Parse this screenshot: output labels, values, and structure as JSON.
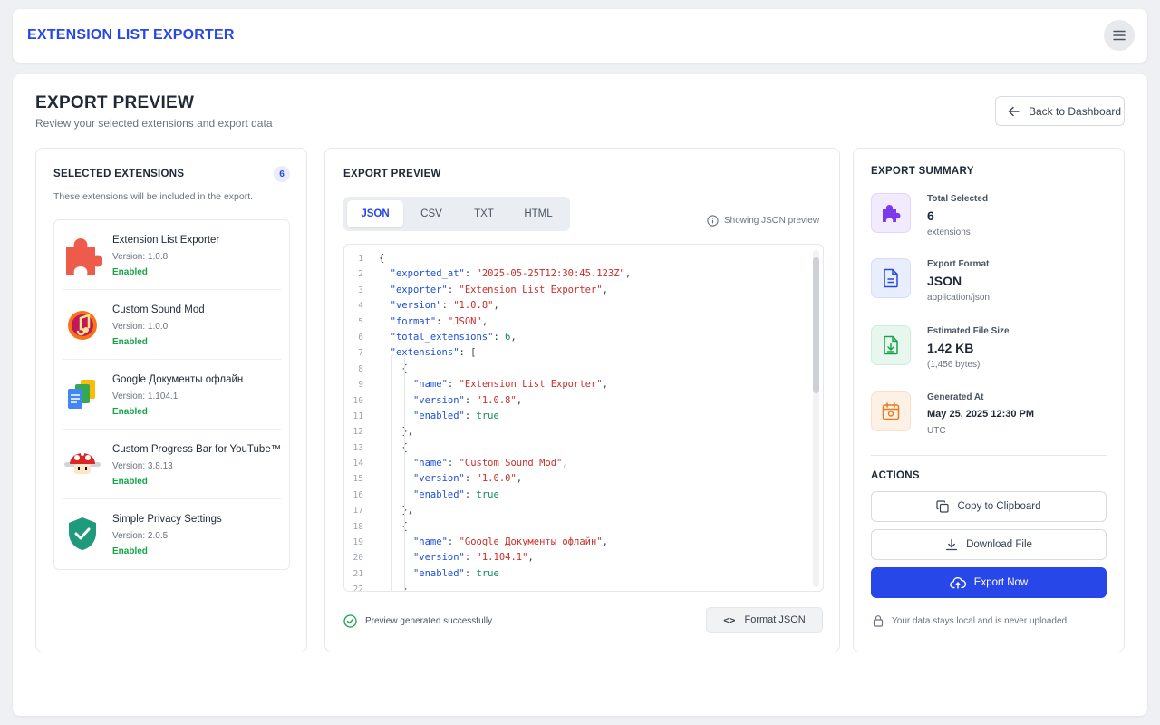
{
  "app": {
    "title": "EXTENSION LIST EXPORTER"
  },
  "header": {
    "title": "EXPORT PREVIEW",
    "subtitle": "Review your selected extensions and export data",
    "back_label": "Back to Dashboard"
  },
  "selected": {
    "title": "SELECTED EXTENSIONS",
    "count": "6",
    "description": "These extensions will be included in the export.",
    "items": [
      {
        "name": "Extension List Exporter",
        "version": "Version: 1.0.8",
        "status": "Enabled",
        "icon": "puzzle-icon"
      },
      {
        "name": "Custom Sound Mod",
        "version": "Version: 1.0.0",
        "status": "Enabled",
        "icon": "music-note-icon"
      },
      {
        "name": "Google Документы офлайн",
        "version": "Version: 1.104.1",
        "status": "Enabled",
        "icon": "google-docs-icon"
      },
      {
        "name": "Custom Progress Bar for YouTube™",
        "version": "Version: 3.8.13",
        "status": "Enabled",
        "icon": "mushroom-icon"
      },
      {
        "name": "Simple Privacy Settings",
        "version": "Version: 2.0.5",
        "status": "Enabled",
        "icon": "shield-check-icon"
      }
    ]
  },
  "preview": {
    "title": "EXPORT PREVIEW",
    "tabs": [
      "JSON",
      "CSV",
      "TXT",
      "HTML"
    ],
    "active_tab": "JSON",
    "showing": "Showing JSON preview",
    "status": "Preview generated successfully",
    "format_button": "Format JSON",
    "code_lines": [
      "{",
      "  \"exported_at\": \"2025-05-25T12:30:45.123Z\",",
      "  \"exporter\": \"Extension List Exporter\",",
      "  \"version\": \"1.0.8\",",
      "  \"format\": \"JSON\",",
      "  \"total_extensions\": 6,",
      "  \"extensions\": [",
      "    {",
      "      \"name\": \"Extension List Exporter\",",
      "      \"version\": \"1.0.8\",",
      "      \"enabled\": true",
      "    },",
      "    {",
      "      \"name\": \"Custom Sound Mod\",",
      "      \"version\": \"1.0.0\",",
      "      \"enabled\": true",
      "    },",
      "    {",
      "      \"name\": \"Google Документы офлайн\",",
      "      \"version\": \"1.104.1\",",
      "      \"enabled\": true",
      "    }"
    ]
  },
  "summary": {
    "title": "EXPORT SUMMARY",
    "items": [
      {
        "label": "Total Selected",
        "value": "6",
        "sub": "extensions",
        "icon": "puzzle-icon",
        "color": "#7c3aed",
        "bg": "#f1ebfd"
      },
      {
        "label": "Export Format",
        "value": "JSON",
        "sub": "application/json",
        "icon": "document-icon",
        "color": "#2747e8",
        "bg": "#e9eefc"
      },
      {
        "label": "Estimated File Size",
        "value": "1.42 KB",
        "sub": "(1,456 bytes)",
        "icon": "file-download-icon",
        "color": "#16a34a",
        "bg": "#e8f7ee"
      },
      {
        "label": "Generated At",
        "value": "May 25, 2025 12:30 PM",
        "sub": "UTC",
        "icon": "calendar-icon",
        "color": "#ea7a1a",
        "bg": "#fdf1e6"
      }
    ],
    "actions_title": "ACTIONS",
    "copy_label": "Copy to Clipboard",
    "download_label": "Download File",
    "export_label": "Export Now",
    "privacy_note": "Your data stays local and is never uploaded."
  },
  "colors": {
    "accent": "#2747e8",
    "success": "#16a34a",
    "string": "#c8302a",
    "key": "#1e4fd8"
  }
}
